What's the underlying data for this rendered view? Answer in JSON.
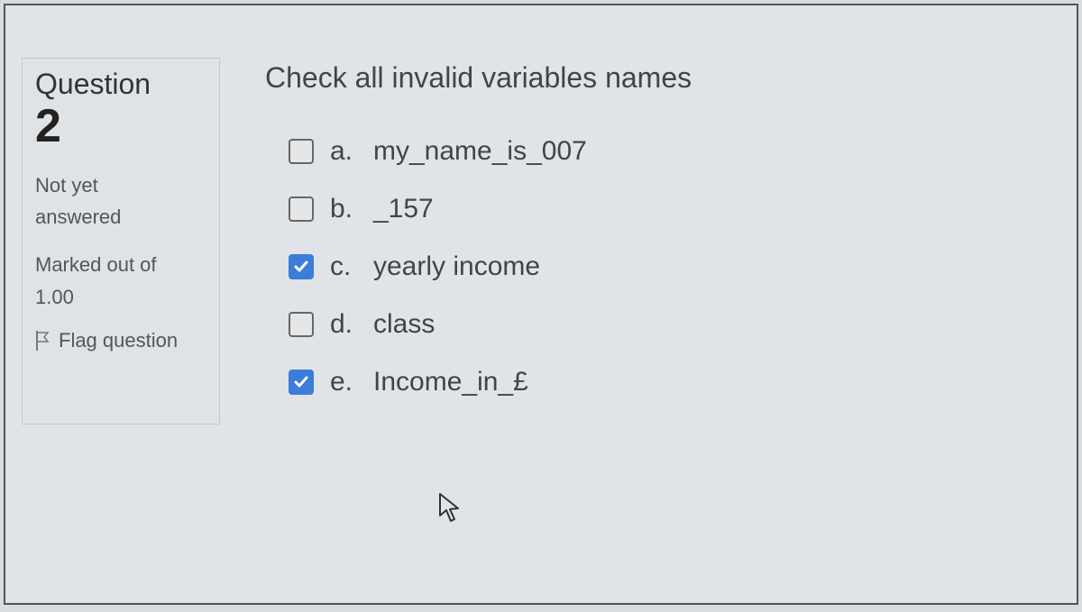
{
  "sidebar": {
    "question_label": "Question",
    "question_number": "2",
    "status_line1": "Not yet",
    "status_line2": "answered",
    "marked_line1": "Marked out of",
    "marked_line2": "1.00",
    "flag_label": "Flag question"
  },
  "question": {
    "prompt": "Check all invalid variables names",
    "answers": [
      {
        "letter": "a.",
        "text": "my_name_is_007",
        "checked": false
      },
      {
        "letter": "b.",
        "text": "_157",
        "checked": false
      },
      {
        "letter": "c.",
        "text": "yearly income",
        "checked": true
      },
      {
        "letter": "d.",
        "text": "class",
        "checked": false
      },
      {
        "letter": "e.",
        "text": "Income_in_£",
        "checked": true
      }
    ]
  }
}
